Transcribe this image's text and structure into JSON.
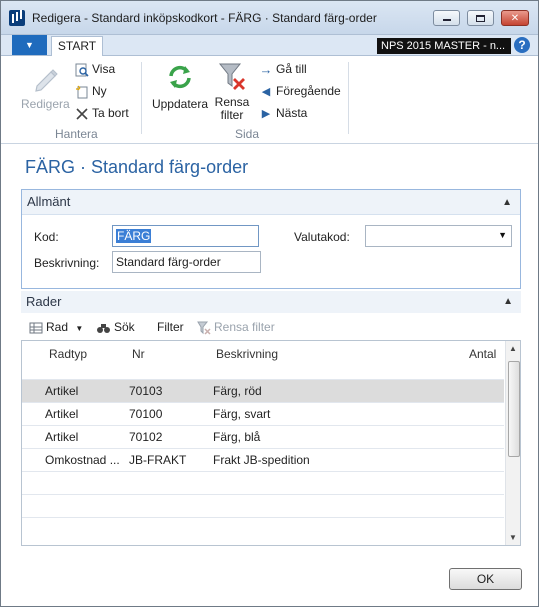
{
  "window": {
    "title": "Redigera - Standard inköpskodkort - FÄRG · Standard färg-order",
    "company": "NPS 2015 MASTER - n...",
    "help": "?"
  },
  "ribbon": {
    "tab_start": "START",
    "manage": {
      "edit": "Redigera",
      "view": "Visa",
      "new": "Ny",
      "delete": "Ta bort",
      "group_label": "Hantera"
    },
    "page": {
      "refresh": "Uppdatera",
      "clear_filter_line1": "Rensa",
      "clear_filter_line2": "filter",
      "goto": "Gå till",
      "previous": "Föregående",
      "next": "Nästa",
      "group_label": "Sida"
    }
  },
  "page_title": "FÄRG · Standard färg-order",
  "general": {
    "header": "Allmänt",
    "code_label": "Kod:",
    "code_value": "FÄRG",
    "description_label": "Beskrivning:",
    "description_value": "Standard färg-order",
    "currency_label": "Valutakod:",
    "currency_value": ""
  },
  "lines": {
    "header": "Rader",
    "toolbar": {
      "row": "Rad",
      "search": "Sök",
      "filter": "Filter",
      "clear_filter": "Rensa filter"
    },
    "columns": [
      "Radtyp",
      "Nr",
      "Beskrivning",
      "Antal"
    ],
    "rows": [
      {
        "type": "Artikel",
        "no": "70103",
        "description": "Färg, röd",
        "qty": ""
      },
      {
        "type": "Artikel",
        "no": "70100",
        "description": "Färg, svart",
        "qty": ""
      },
      {
        "type": "Artikel",
        "no": "70102",
        "description": "Färg, blå",
        "qty": ""
      },
      {
        "type": "Omkostnad ...",
        "no": "JB-FRAKT",
        "description": "Frakt JB-spedition",
        "qty": ""
      }
    ]
  },
  "ok_button": "OK"
}
